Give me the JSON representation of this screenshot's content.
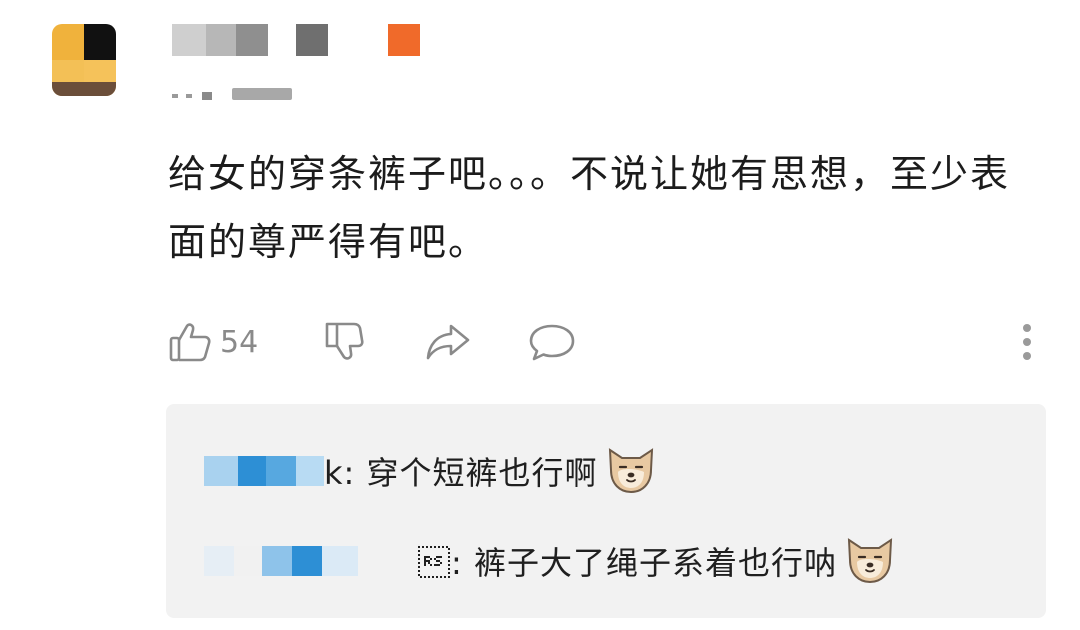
{
  "comment": {
    "text": "给女的穿条裤子吧。。。不说让她有思想，至少表面的尊严得有吧。",
    "likes": "54"
  },
  "replies": [
    {
      "text": "k: 穿个短裤也行啊",
      "emoji": "dog-face-icon"
    },
    {
      "text": "\u001e: 裤子大了绳子系着也行呐",
      "emoji": "dog-face-icon"
    }
  ],
  "colors": {
    "reply_bg": "#f2f2f2",
    "icon_gray": "#8a8a8a",
    "mosaic_blue": "#2c8fd6",
    "mosaic_orange": "#f06a2a"
  }
}
